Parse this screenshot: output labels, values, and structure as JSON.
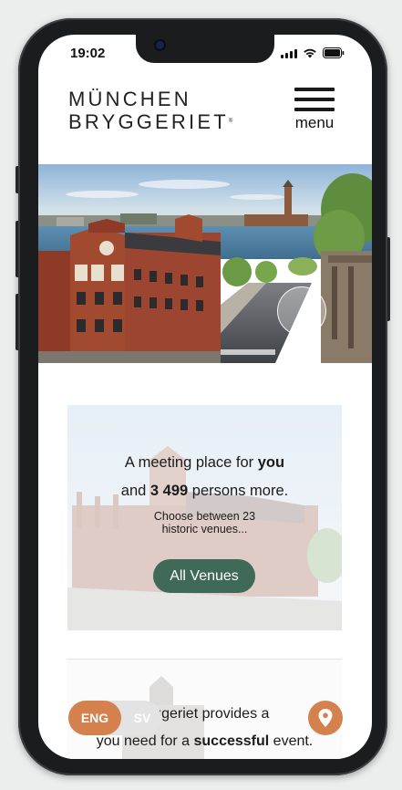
{
  "status_bar": {
    "time": "19:02",
    "icons": [
      "cellular-signal-icon",
      "wifi-icon",
      "battery-icon"
    ]
  },
  "header": {
    "logo_line1": "MÜNCHEN",
    "logo_line2": "BRYGGERIET",
    "logo_mark": "®",
    "menu_icon": "hamburger-icon",
    "menu_label": "menu"
  },
  "venue_card": {
    "line1_prefix": "A meeting place for ",
    "line1_bold": "you",
    "line2_prefix": "and ",
    "line2_bold": "3 499",
    "line2_suffix": " persons more.",
    "subtitle_line1": "Choose between 23",
    "subtitle_line2": "historic venues...",
    "button_label": "All Venues"
  },
  "second_card": {
    "line1_text": "bryggeriet provides a",
    "line2_prefix": "you need for a ",
    "line2_bold": "successful",
    "line2_suffix": " event."
  },
  "language_switch": {
    "eng_label": "ENG",
    "sv_label": "SV",
    "active": "ENG"
  },
  "location_button": {
    "icon": "map-pin-icon"
  },
  "colors": {
    "accent_orange": "#d4814d",
    "button_green": "#3f6a57",
    "text_dark": "#1c1c1c"
  }
}
